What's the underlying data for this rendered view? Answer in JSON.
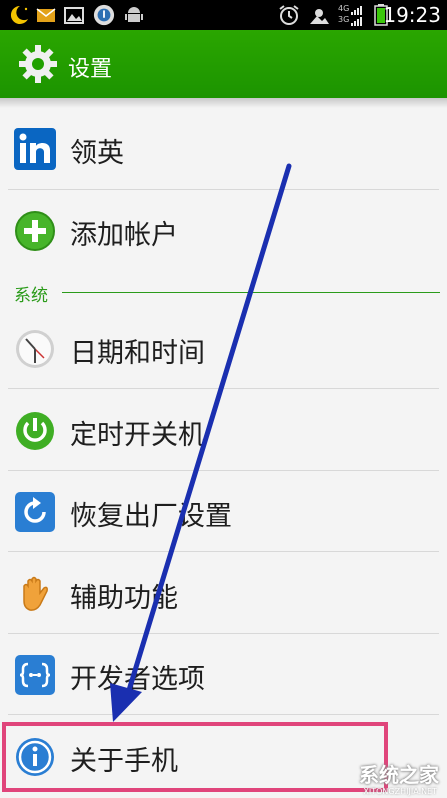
{
  "status_bar": {
    "time": "19:23",
    "signal_labels": [
      "4G",
      "3G"
    ]
  },
  "header": {
    "title": "设置"
  },
  "items": [
    {
      "label": "领英",
      "icon": "linkedin-icon"
    },
    {
      "label": "添加帐户",
      "icon": "add-icon"
    }
  ],
  "section_title": "系统",
  "system_items": [
    {
      "label": "日期和时间",
      "icon": "clock-icon"
    },
    {
      "label": "定时开关机",
      "icon": "power-icon"
    },
    {
      "label": "恢复出厂设置",
      "icon": "restore-icon"
    },
    {
      "label": "辅助功能",
      "icon": "hand-icon"
    },
    {
      "label": "开发者选项",
      "icon": "developer-icon"
    },
    {
      "label": "关于手机",
      "icon": "info-icon"
    }
  ],
  "watermark": {
    "text": "系统之家",
    "sub": "XITONGZHIJIA.NET"
  },
  "colors": {
    "action_bar": "#1c9400",
    "section": "#2b9b1a",
    "highlight": "#e0457b",
    "arrow": "#1a2fb0"
  }
}
